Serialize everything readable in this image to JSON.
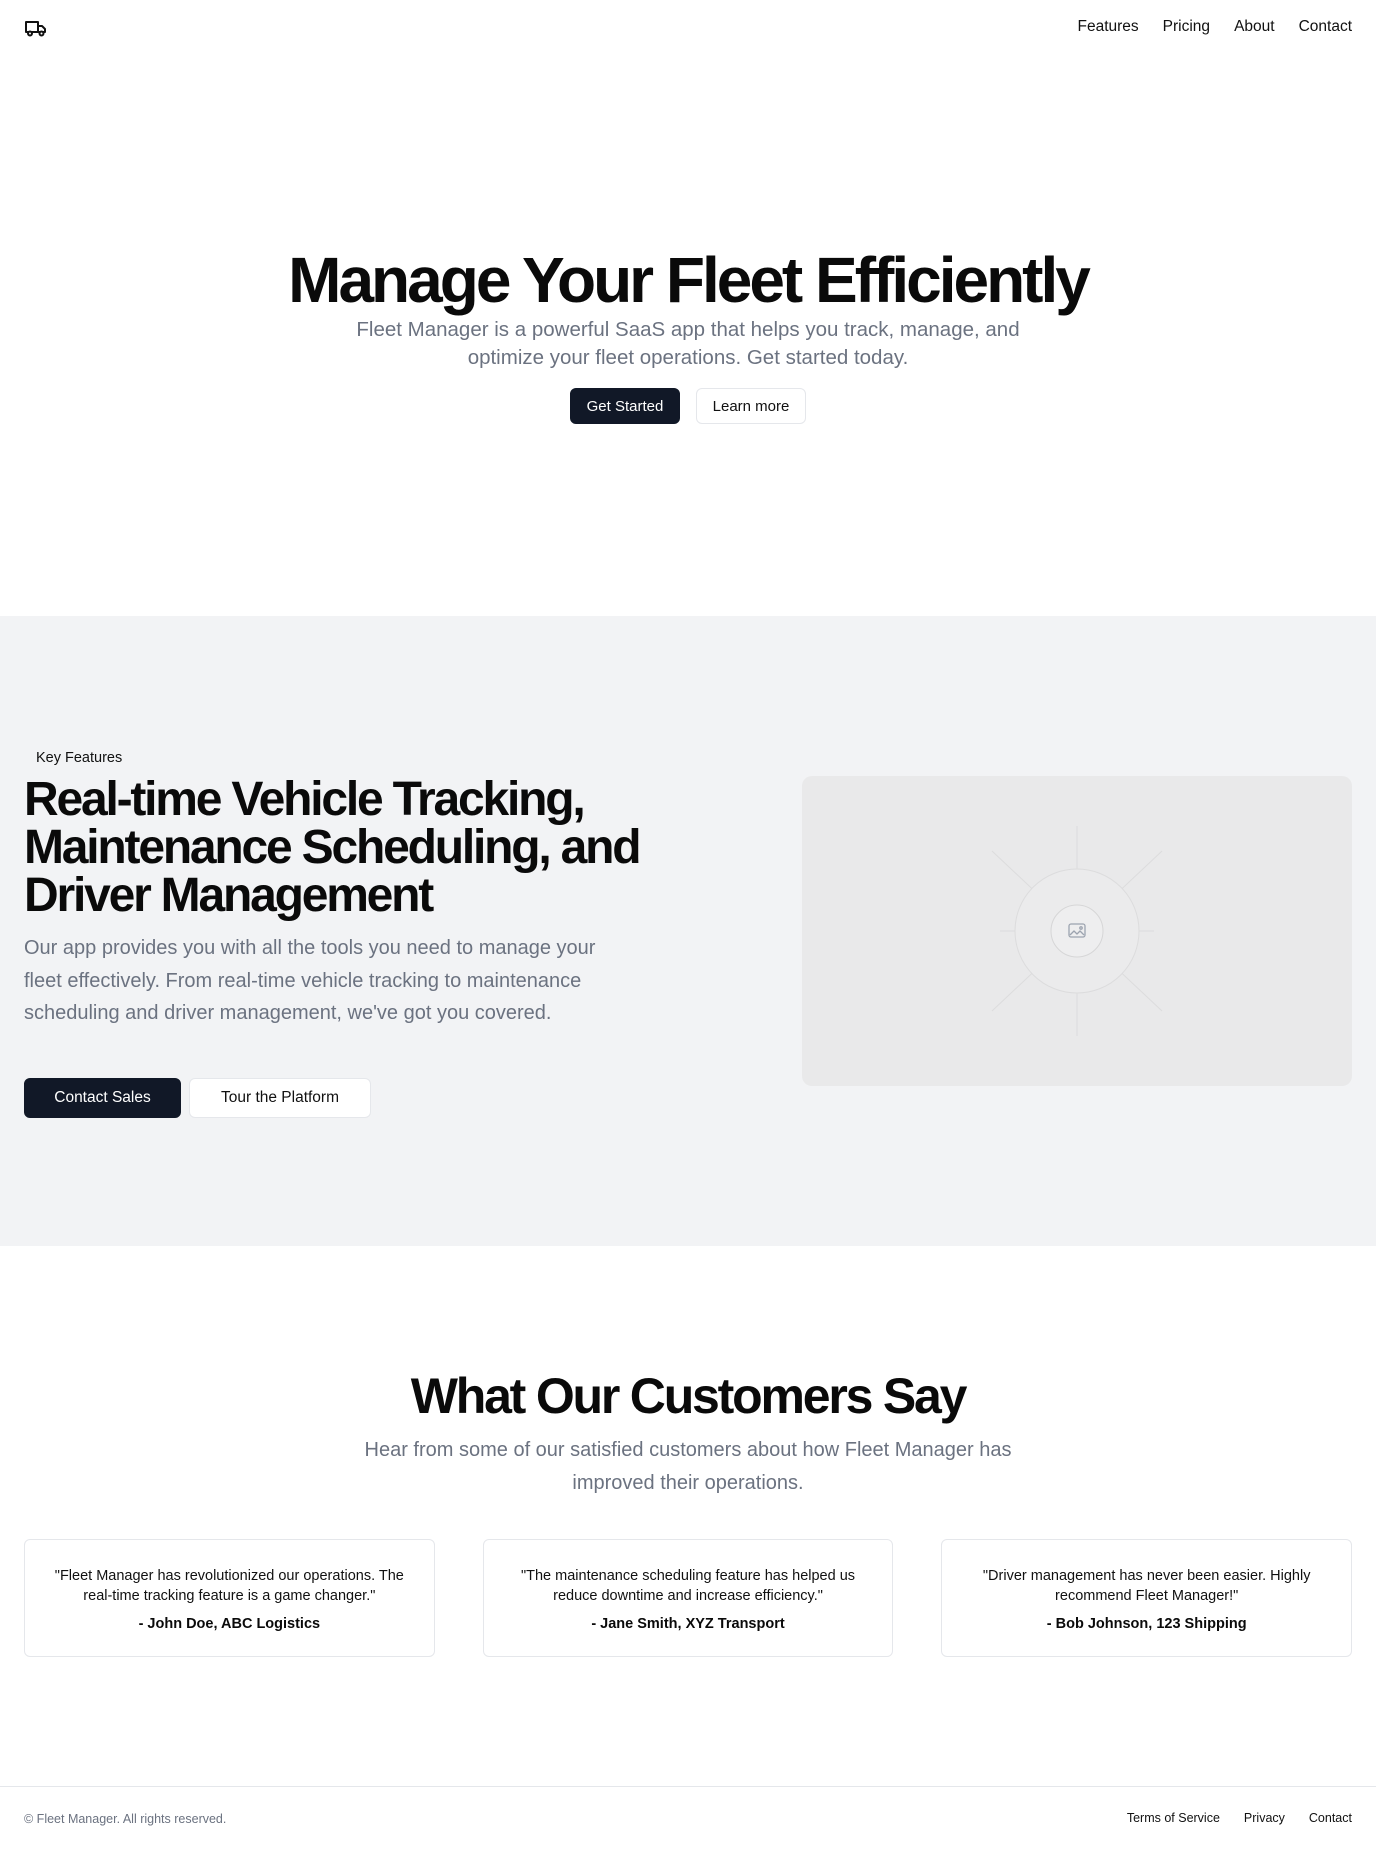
{
  "header": {
    "logo_icon": "truck-icon",
    "nav": [
      "Features",
      "Pricing",
      "About",
      "Contact"
    ]
  },
  "hero": {
    "title": "Manage Your Fleet Efficiently",
    "subtitle": "Fleet Manager is a powerful SaaS app that helps you track, manage, and optimize your fleet operations. Get started today.",
    "primary_button": "Get Started",
    "secondary_button": "Learn more"
  },
  "features": {
    "badge": "Key Features",
    "title": "Real-time Vehicle Tracking, Maintenance Scheduling, and Driver Management",
    "description": "Our app provides you with all the tools you need to manage your fleet effectively. From real-time vehicle tracking to maintenance scheduling and driver management, we've got you covered.",
    "primary_button": "Contact Sales",
    "secondary_button": "Tour the Platform",
    "image_icon": "image-placeholder-icon"
  },
  "testimonials": {
    "title": "What Our Customers Say",
    "subtitle": "Hear from some of our satisfied customers about how Fleet Manager has improved their operations.",
    "items": [
      {
        "quote": "\"Fleet Manager has revolutionized our operations. The real-time tracking feature is a game changer.\"",
        "author": "- John Doe, ABC Logistics"
      },
      {
        "quote": "\"The maintenance scheduling feature has helped us reduce downtime and increase efficiency.\"",
        "author": "- Jane Smith, XYZ Transport"
      },
      {
        "quote": "\"Driver management has never been easier. Highly recommend Fleet Manager!\"",
        "author": "- Bob Johnson, 123 Shipping"
      }
    ]
  },
  "footer": {
    "copyright": "© Fleet Manager. All rights reserved.",
    "links": [
      "Terms of Service",
      "Privacy",
      "Contact"
    ]
  },
  "colors": {
    "primary_button": "#111827",
    "muted_text": "#6b7280",
    "section_bg": "#f2f3f5",
    "border": "#e5e7eb"
  }
}
